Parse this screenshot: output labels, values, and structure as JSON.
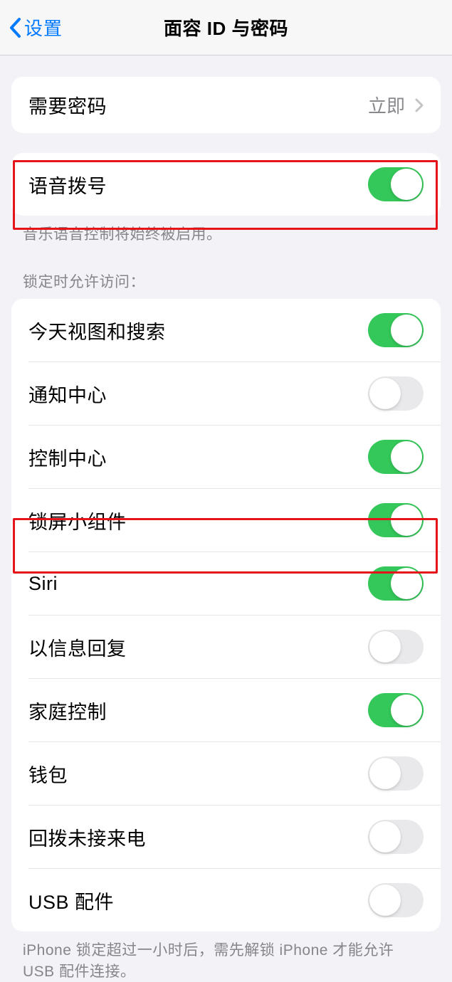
{
  "header": {
    "back_label": "设置",
    "title": "面容 ID 与密码"
  },
  "passcode_group": {
    "require_passcode": {
      "label": "需要密码",
      "value": "立即"
    }
  },
  "voice_dial": {
    "label": "语音拨号",
    "on": true,
    "footer": "音乐语音控制将始终被启用。"
  },
  "locked_access": {
    "header": "锁定时允许访问：",
    "items": [
      {
        "label": "今天视图和搜索",
        "on": true
      },
      {
        "label": "通知中心",
        "on": false
      },
      {
        "label": "控制中心",
        "on": true
      },
      {
        "label": "锁屏小组件",
        "on": true
      },
      {
        "label": "Siri",
        "on": true
      },
      {
        "label": "以信息回复",
        "on": false
      },
      {
        "label": "家庭控制",
        "on": true
      },
      {
        "label": "钱包",
        "on": false
      },
      {
        "label": "回拨未接来电",
        "on": false
      },
      {
        "label": "USB 配件",
        "on": false
      }
    ],
    "footer": "iPhone 锁定超过一小时后，需先解锁 iPhone 才能允许  USB 配件连接。"
  }
}
